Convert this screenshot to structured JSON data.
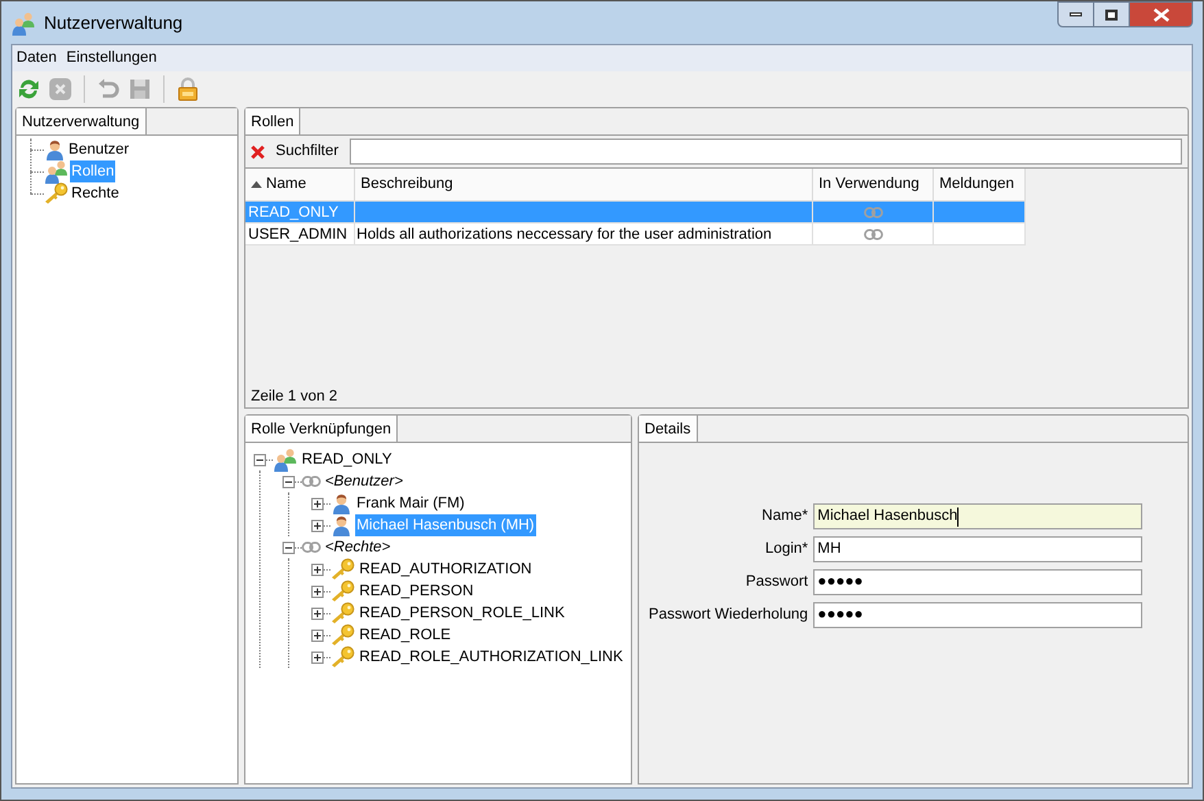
{
  "window": {
    "title": "Nutzerverwaltung"
  },
  "menu": [
    {
      "label": "Daten"
    },
    {
      "label": "Einstellungen"
    }
  ],
  "toolbar": [
    {
      "kind": "refresh",
      "disabled": false
    },
    {
      "kind": "cancel",
      "disabled": true
    },
    {
      "kind": "separator"
    },
    {
      "kind": "undo",
      "disabled": true
    },
    {
      "kind": "save",
      "disabled": true
    },
    {
      "kind": "separator"
    },
    {
      "kind": "lock",
      "disabled": false
    }
  ],
  "navigation": {
    "tab": "Nutzerverwaltung",
    "items": [
      {
        "label": "Benutzer",
        "kind": "user",
        "selected": false
      },
      {
        "label": "Rollen",
        "kind": "role",
        "selected": true
      },
      {
        "label": "Rechte",
        "kind": "right",
        "selected": false
      }
    ]
  },
  "roles": {
    "tab": "Rollen",
    "filter": {
      "label": "Suchfilter"
    },
    "columns": [
      {
        "label": "Name",
        "sorted": true
      },
      {
        "label": "Beschreibung",
        "sorted": false
      },
      {
        "label": "In Verwendung",
        "sorted": false
      },
      {
        "label": "Meldungen",
        "sorted": false
      }
    ],
    "rows": [
      {
        "name": "READ_ONLY",
        "in_use": true,
        "selected": true
      },
      {
        "name": "USER_ADMIN",
        "description": "Holds all authorizations neccessary for the user administration",
        "in_use": true,
        "selected": false
      }
    ],
    "status": "Zeile 1 von 2"
  },
  "links": {
    "tab": "Rolle Verknüpfungen",
    "tree": [
      {
        "label": "READ_ONLY",
        "kind": "role",
        "expanded": true,
        "selected": false,
        "children": [
          {
            "label": "<Benutzer>",
            "kind": "group",
            "expanded": true,
            "selected": false,
            "children": [
              {
                "label": "Frank Mair (FM)",
                "kind": "user",
                "expanded": false,
                "selected": false
              },
              {
                "label": "Michael Hasenbusch (MH)",
                "kind": "user",
                "expanded": false,
                "selected": true
              }
            ]
          },
          {
            "label": "<Rechte>",
            "kind": "group",
            "expanded": true,
            "selected": false,
            "children": [
              {
                "label": "READ_AUTHORIZATION",
                "kind": "right",
                "expanded": false,
                "selected": false
              },
              {
                "label": "READ_PERSON",
                "kind": "right",
                "expanded": false,
                "selected": false
              },
              {
                "label": "READ_PERSON_ROLE_LINK",
                "kind": "right",
                "expanded": false,
                "selected": false
              },
              {
                "label": "READ_ROLE",
                "kind": "right",
                "expanded": false,
                "selected": false
              },
              {
                "label": "READ_ROLE_AUTHORIZATION_LINK",
                "kind": "right",
                "expanded": false,
                "selected": false
              }
            ]
          }
        ]
      }
    ]
  },
  "details": {
    "tab": "Details",
    "fields": [
      {
        "label": "Name*",
        "value": "Michael Hasenbusch",
        "focused": true
      },
      {
        "label": "Login*",
        "value": "MH",
        "focused": false
      },
      {
        "label": "Passwort",
        "value": "●●●●●",
        "focused": false
      },
      {
        "label": "Passwort Wiederholung",
        "value": "●●●●●",
        "focused": false
      }
    ]
  }
}
